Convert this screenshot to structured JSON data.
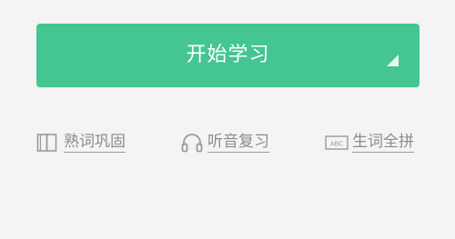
{
  "primary_action": {
    "label": "开始学习",
    "color": "#45c592",
    "corner_icon": "triangle-corner-icon"
  },
  "quick_links": [
    {
      "label": "熟词巩固",
      "icon": "book-icon"
    },
    {
      "label": "听音复习",
      "icon": "headphones-icon"
    },
    {
      "label": "生词全拼",
      "icon": "abc-icon"
    }
  ],
  "colors": {
    "background": "#f4f4f4",
    "link_text": "#8c8c8c"
  }
}
